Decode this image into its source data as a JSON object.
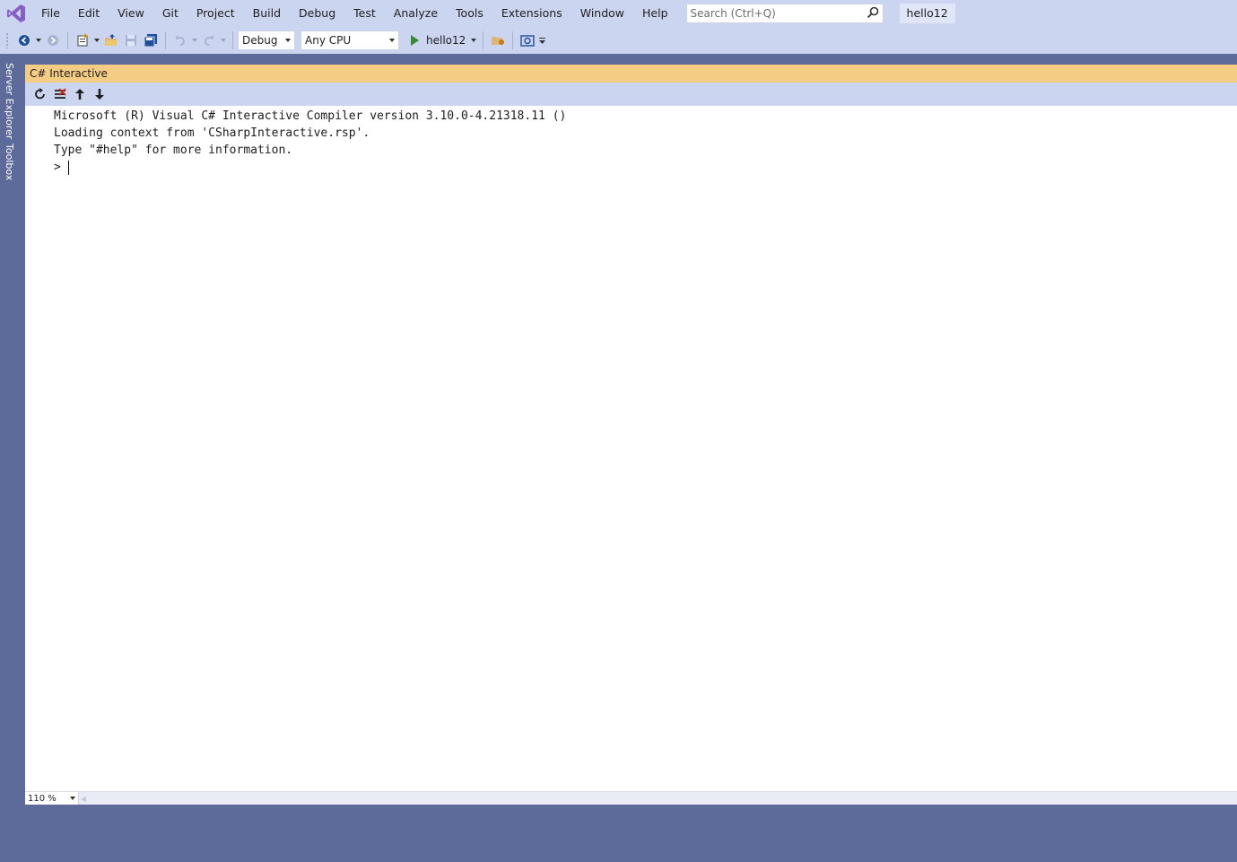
{
  "menubar": {
    "items": [
      "File",
      "Edit",
      "View",
      "Git",
      "Project",
      "Build",
      "Debug",
      "Test",
      "Analyze",
      "Tools",
      "Extensions",
      "Window",
      "Help"
    ],
    "search_placeholder": "Search (Ctrl+Q)",
    "solution_name": "hello12"
  },
  "toolbar": {
    "configuration": "Debug",
    "platform": "Any CPU",
    "start_target": "hello12"
  },
  "side_tabs": [
    "Server Explorer",
    "Toolbox"
  ],
  "tool_window": {
    "title": "C# Interactive",
    "lines": [
      "Microsoft (R) Visual C# Interactive Compiler version 3.10.0-4.21318.11 ()",
      "Loading context from 'CSharpInteractive.rsp'.",
      "Type \"#help\" for more information."
    ],
    "prompt": ">",
    "zoom": "110 %"
  },
  "colors": {
    "chrome": "#ccd5f0",
    "frame": "#5c6b99",
    "active_tab": "#f5cc84",
    "vs_purple": "#865fc5"
  }
}
